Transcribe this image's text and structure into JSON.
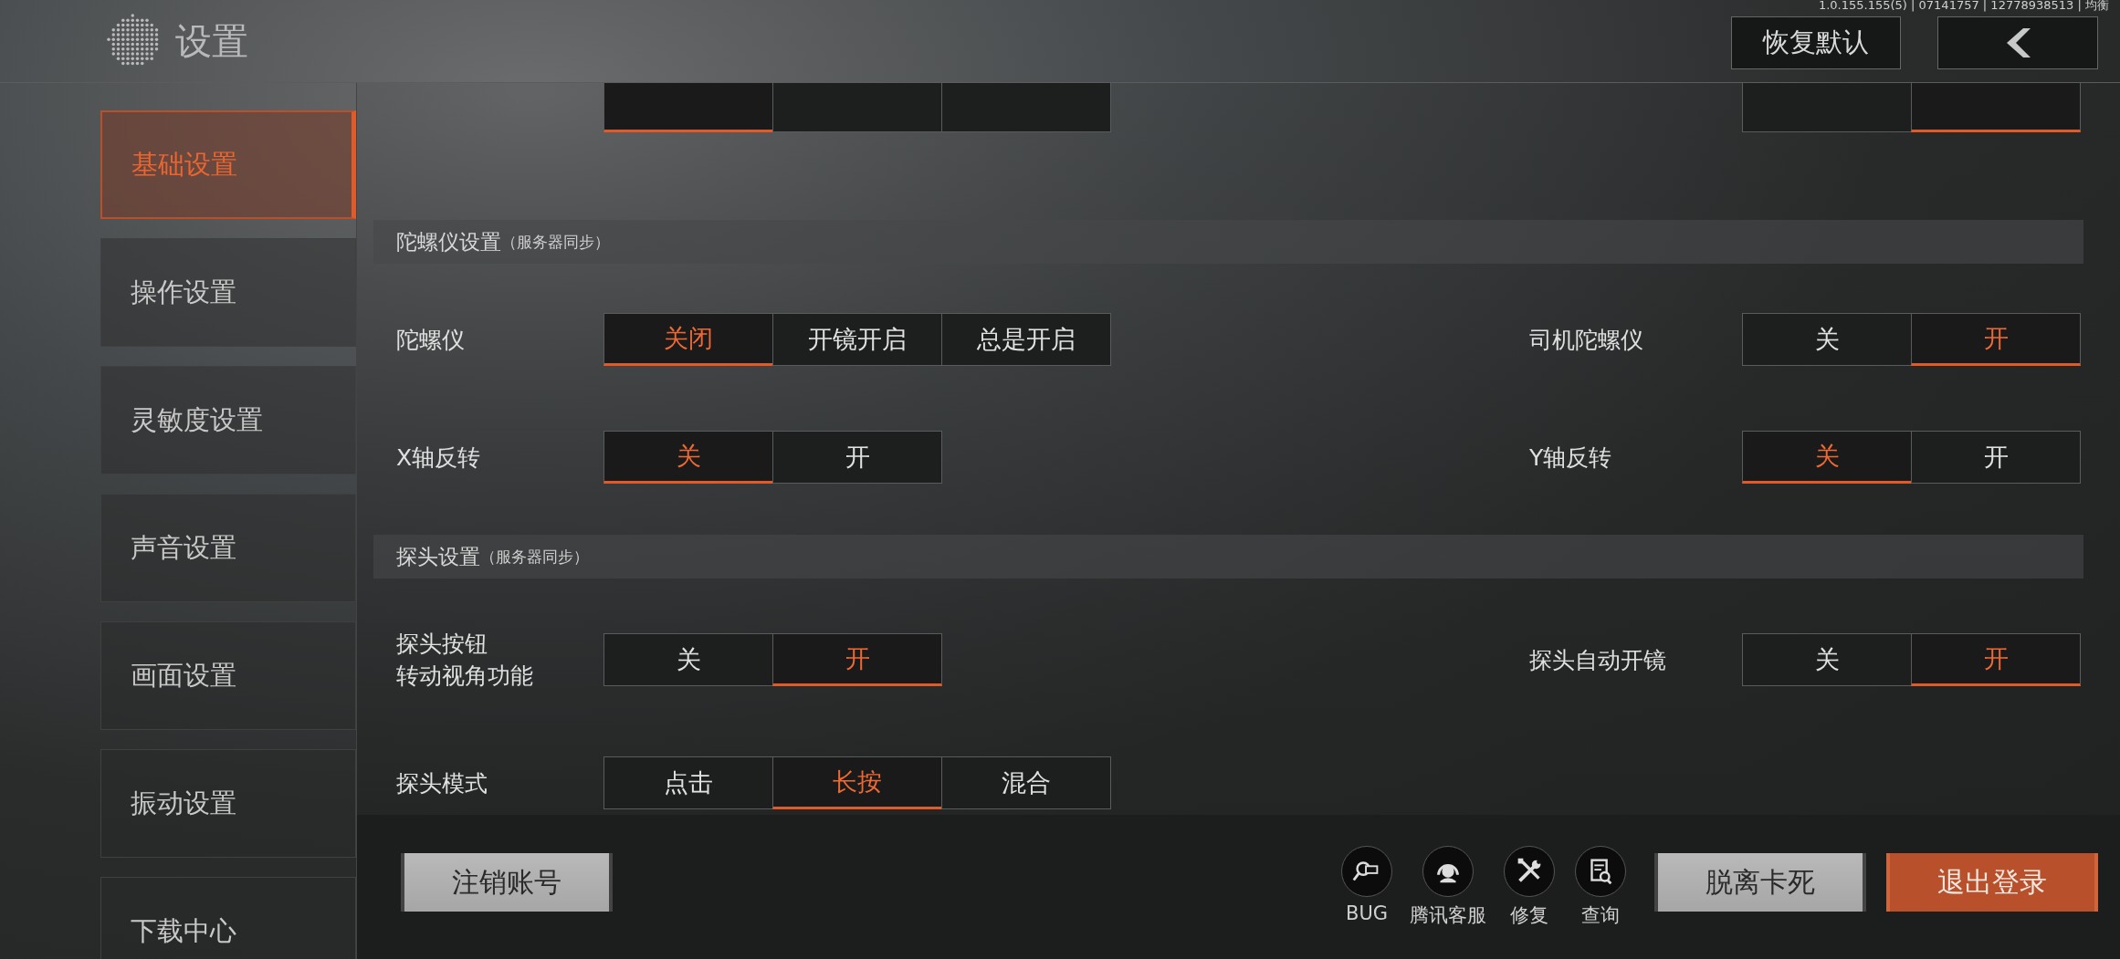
{
  "header": {
    "title": "设置",
    "version": "1.0.155.155(5) | 07141757 | 12778938513 | 均衡",
    "buttons": [
      {
        "kind": "text",
        "label": "恢复默认"
      },
      {
        "kind": "back"
      }
    ]
  },
  "sidebar": {
    "items": [
      {
        "label": "基础设置",
        "selected": true
      },
      {
        "label": "操作设置",
        "selected": false
      },
      {
        "label": "灵敏度设置",
        "selected": false
      },
      {
        "label": "声音设置",
        "selected": false
      },
      {
        "label": "画面设置",
        "selected": false
      },
      {
        "label": "振动设置",
        "selected": false
      },
      {
        "label": "下载中心",
        "selected": false
      }
    ]
  },
  "settings": [
    {
      "kind": "partial",
      "columns": [
        {
          "options": [
            {
              "selected": true
            },
            {
              "selected": false
            },
            {
              "selected": false
            }
          ]
        },
        {
          "options": [
            {
              "selected": false
            },
            {
              "selected": true
            }
          ]
        }
      ]
    },
    {
      "kind": "section",
      "title": "陀螺仪设置",
      "note": "（服务器同步）"
    },
    {
      "kind": "row",
      "columns": [
        {
          "label": "陀螺仪",
          "options": [
            {
              "label": "关闭",
              "selected": true
            },
            {
              "label": "开镜开启",
              "selected": false
            },
            {
              "label": "总是开启",
              "selected": false
            }
          ]
        },
        {
          "label": "司机陀螺仪",
          "options": [
            {
              "label": "关",
              "selected": false
            },
            {
              "label": "开",
              "selected": true
            }
          ]
        }
      ]
    },
    {
      "kind": "row",
      "columns": [
        {
          "label": "X轴反转",
          "options": [
            {
              "label": "关",
              "selected": true
            },
            {
              "label": "开",
              "selected": false
            }
          ]
        },
        {
          "label": "Y轴反转",
          "options": [
            {
              "label": "关",
              "selected": true
            },
            {
              "label": "开",
              "selected": false
            }
          ]
        }
      ]
    },
    {
      "kind": "section",
      "title": "探头设置",
      "note": "（服务器同步）"
    },
    {
      "kind": "row",
      "columns": [
        {
          "label_lines": [
            "探头按钮",
            "转动视角功能"
          ],
          "options": [
            {
              "label": "关",
              "selected": false
            },
            {
              "label": "开",
              "selected": true
            }
          ]
        },
        {
          "label": "探头自动开镜",
          "options": [
            {
              "label": "关",
              "selected": false
            },
            {
              "label": "开",
              "selected": true
            }
          ]
        }
      ]
    },
    {
      "kind": "row",
      "columns": [
        {
          "label": "探头模式",
          "options": [
            {
              "label": "点击",
              "selected": false
            },
            {
              "label": "长按",
              "selected": true
            },
            {
              "label": "混合",
              "selected": false
            }
          ]
        }
      ]
    }
  ],
  "bottom": {
    "left_button": "注销账号",
    "tools": [
      {
        "kind": "bug",
        "label": "BUG"
      },
      {
        "kind": "headset",
        "label": "腾讯客服"
      },
      {
        "kind": "repair",
        "label": "修复"
      },
      {
        "kind": "query",
        "label": "查询"
      }
    ],
    "buttons": [
      {
        "kind": "secondary",
        "label": "脱离卡死"
      },
      {
        "kind": "primary",
        "label": "退出登录"
      }
    ]
  }
}
